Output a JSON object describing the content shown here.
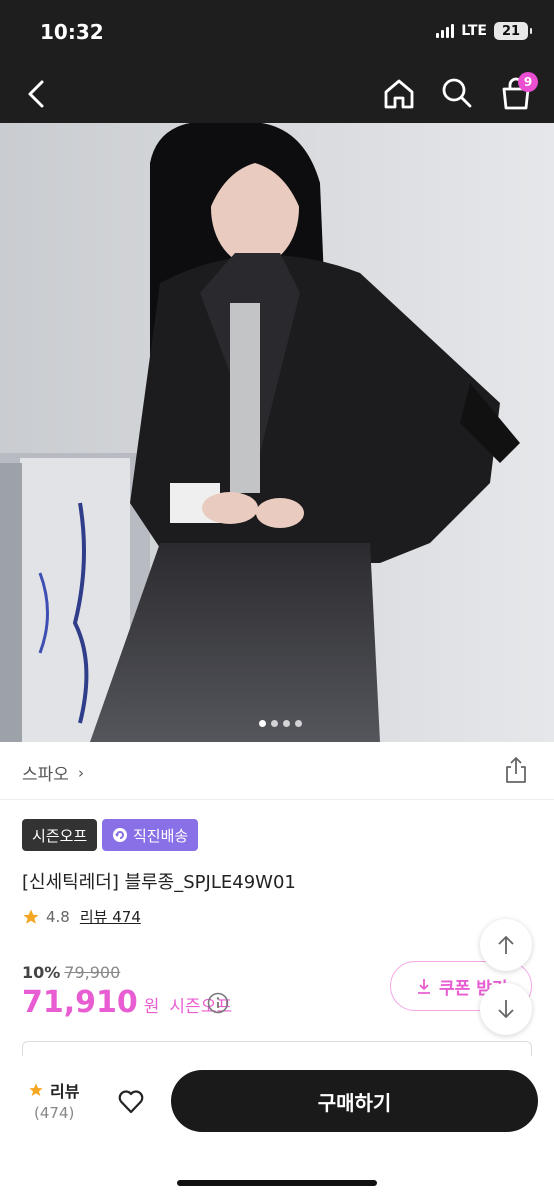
{
  "status_bar": {
    "time": "10:32",
    "network": "LTE",
    "battery": "21"
  },
  "nav": {
    "back_icon": "chevron-left-icon",
    "home_icon": "home-icon",
    "search_icon": "search-icon",
    "cart_icon": "shopping-bag-icon",
    "cart_count": "9"
  },
  "gallery": {
    "image_count": 4,
    "active_index": 0
  },
  "brand": {
    "name": "스파오",
    "chevron": "›"
  },
  "badges": {
    "season": "시즌오프",
    "direct": "직진배송"
  },
  "product": {
    "title": "[신세틱레더] 블루종_SPJLE49W01",
    "rating": "4.8",
    "review_label": "리뷰 474",
    "discount": "10%",
    "original_price": "79,900",
    "price": "71,910",
    "currency": "원",
    "price_tag": "시즌오프"
  },
  "coupon": {
    "label": "쿠폰 받기"
  },
  "bottom": {
    "review_label": "리뷰",
    "review_count": "(474)",
    "buy_label": "구매하기"
  },
  "colors": {
    "accent": "#e85ed2",
    "direct_badge": "#8a70e6",
    "dark": "#1a1a1a"
  }
}
